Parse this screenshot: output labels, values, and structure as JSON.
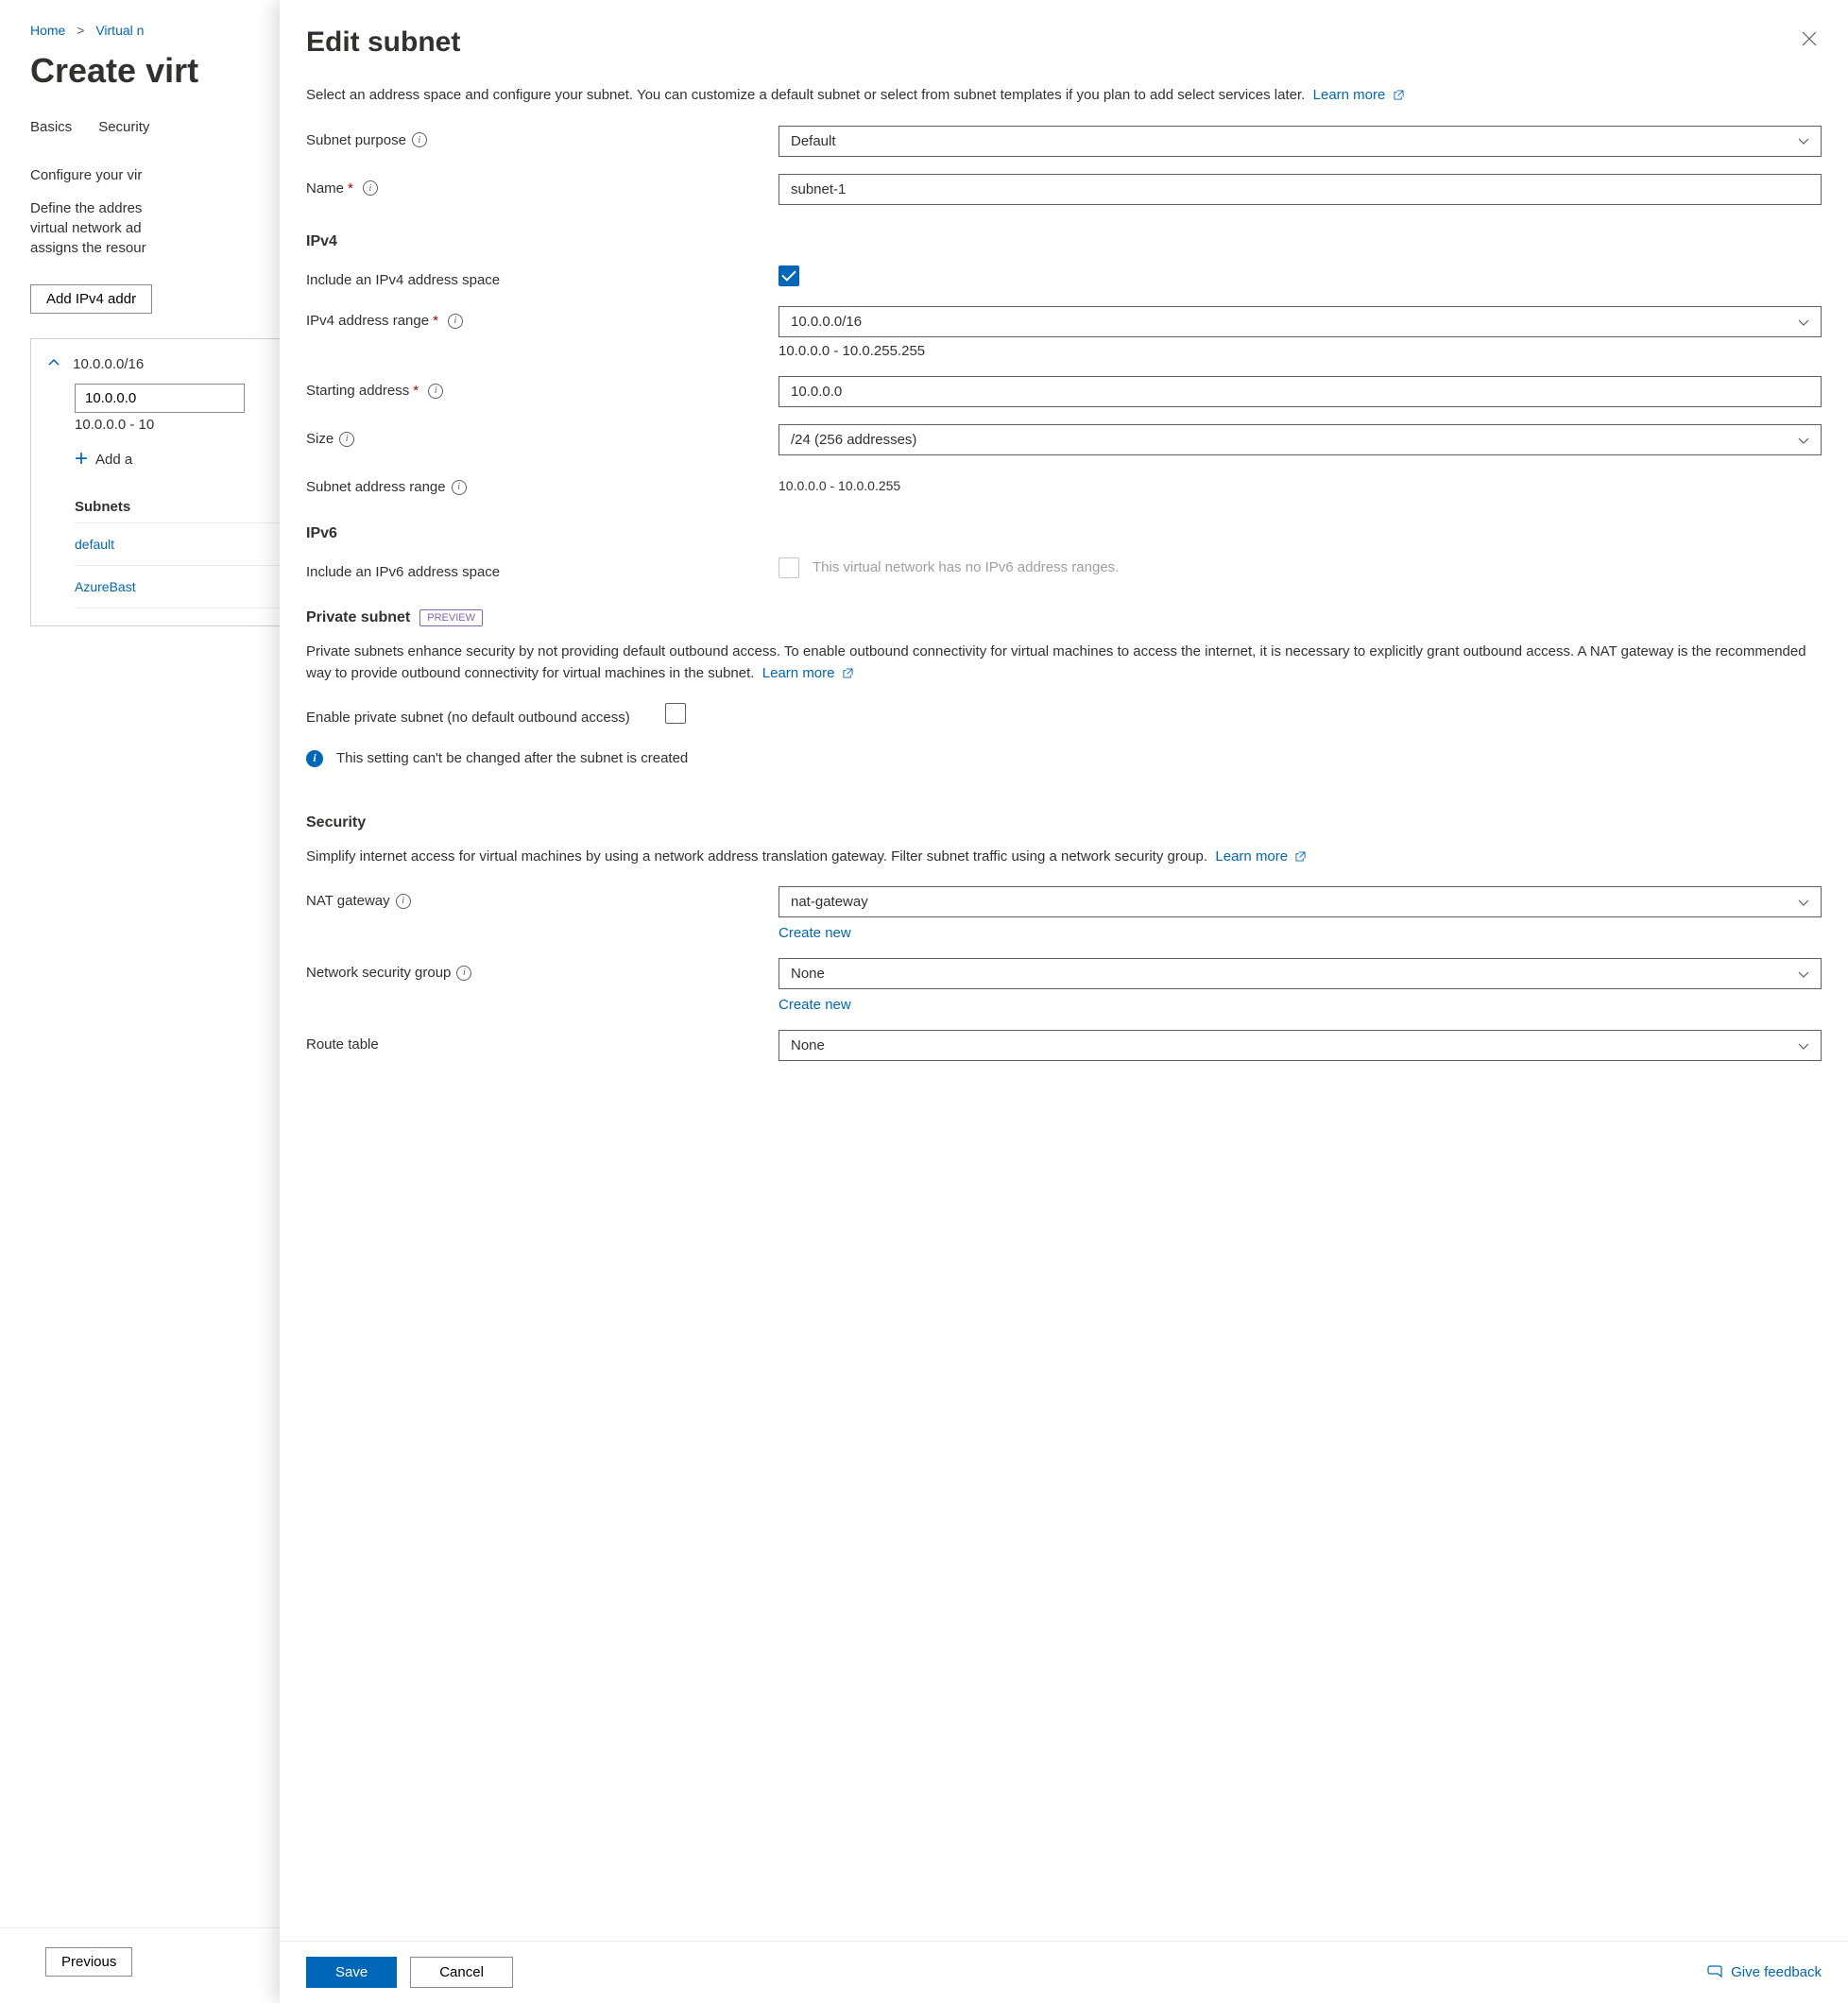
{
  "breadcrumb": {
    "home": "Home",
    "item2": "Virtual n"
  },
  "bg": {
    "title": "Create virt",
    "tabs": {
      "basics": "Basics",
      "security": "Security"
    },
    "configure_line": "Configure your vir",
    "define_line": "Define the addres virtual network ad assigns the resour",
    "add_button": "Add IPv4 addr",
    "ip_cidr": "10.0.0.0/16",
    "ip_start": "10.0.0.0",
    "ip_range": "10.0.0.0 - 10",
    "add_sub": "Add a",
    "subnets_hdr": "Subnets",
    "subnets": {
      "r1": "default",
      "r2": "AzureBast"
    },
    "prev_button": "Previous"
  },
  "panel": {
    "title": "Edit subnet",
    "description": "Select an address space and configure your subnet. You can customize a default subnet or select from subnet templates if you plan to add select services later.",
    "learn_more": "Learn more",
    "subnet_purpose_label": "Subnet purpose",
    "subnet_purpose_value": "Default",
    "name_label": "Name",
    "name_value": "subnet-1",
    "ipv4_title": "IPv4",
    "include_ipv4_label": "Include an IPv4 address space",
    "ipv4_range_label": "IPv4 address range",
    "ipv4_range_value": "10.0.0.0/16",
    "ipv4_range_helper": "10.0.0.0 - 10.0.255.255",
    "starting_addr_label": "Starting address",
    "starting_addr_value": "10.0.0.0",
    "size_label": "Size",
    "size_value": "/24 (256 addresses)",
    "subnet_addr_range_label": "Subnet address range",
    "subnet_addr_range_value": "10.0.0.0 - 10.0.0.255",
    "ipv6_title": "IPv6",
    "include_ipv6_label": "Include an IPv6 address space",
    "include_ipv6_hint": "This virtual network has no IPv6 address ranges.",
    "private_title": "Private subnet",
    "preview_badge": "PREVIEW",
    "private_desc": "Private subnets enhance security by not providing default outbound access. To enable outbound connectivity for virtual machines to access the internet, it is necessary to explicitly grant outbound access. A NAT gateway is the recommended way to provide outbound connectivity for virtual machines in the subnet.",
    "enable_private_label": "Enable private subnet (no default outbound access)",
    "private_warning": "This setting can't be changed after the subnet is created",
    "security_title": "Security",
    "security_desc": "Simplify internet access for virtual machines by using a network address translation gateway. Filter subnet traffic using a network security group.",
    "nat_label": "NAT gateway",
    "nat_value": "nat-gateway",
    "create_new": "Create new",
    "nsg_label": "Network security group",
    "nsg_value": "None",
    "route_label": "Route table",
    "route_value": "None",
    "save": "Save",
    "cancel": "Cancel",
    "feedback": "Give feedback"
  }
}
